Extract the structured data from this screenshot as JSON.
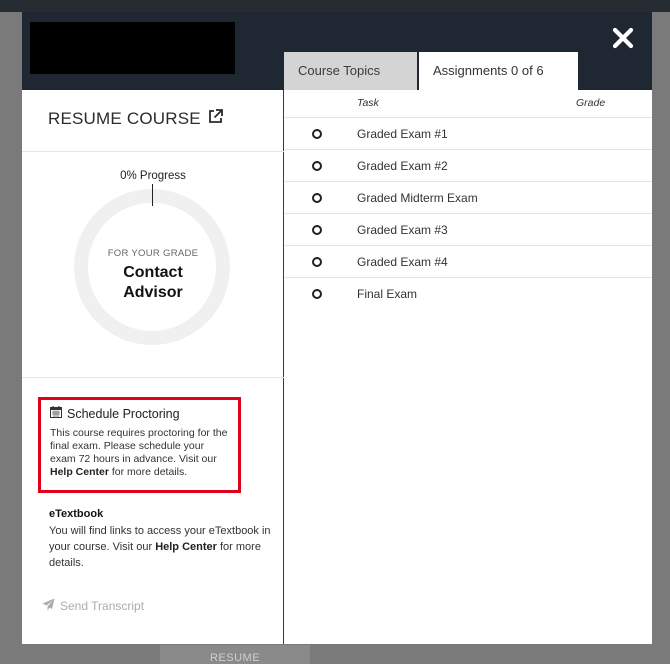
{
  "modal": {
    "resume_label": "RESUME COURSE",
    "tabs": [
      {
        "label": "Course Topics"
      },
      {
        "label": "Assignments 0 of 6"
      }
    ]
  },
  "progress": {
    "label": "0% Progress",
    "percent": 0,
    "grade_caption": "FOR YOUR GRADE",
    "grade_value_line1": "Contact",
    "grade_value_line2": "Advisor"
  },
  "proctoring": {
    "title": "Schedule Proctoring",
    "text": "This course requires proctoring for the final exam. Please schedule your exam 72 hours in advance. Visit our",
    "link": "Help Center",
    "suffix": "for more details."
  },
  "etextbook": {
    "title": "eTextbook",
    "text": "You will find links to access your eTextbook in your course. Visit our",
    "link": "Help Center",
    "suffix": "for more details."
  },
  "send_transcript": "Send Transcript",
  "assignments": {
    "headers": {
      "task": "Task",
      "grade": "Grade"
    },
    "rows": [
      {
        "task": "Graded Exam #1",
        "grade": ""
      },
      {
        "task": "Graded Exam #2",
        "grade": ""
      },
      {
        "task": "Graded Midterm Exam",
        "grade": ""
      },
      {
        "task": "Graded Exam #3",
        "grade": ""
      },
      {
        "task": "Graded Exam #4",
        "grade": ""
      },
      {
        "task": "Final Exam",
        "grade": ""
      }
    ]
  },
  "background": {
    "footer_button": "RESUME"
  },
  "colors": {
    "header_bg": "#1f2732",
    "highlight_border": "#e0001a",
    "muted_action": "#a6adb3"
  }
}
